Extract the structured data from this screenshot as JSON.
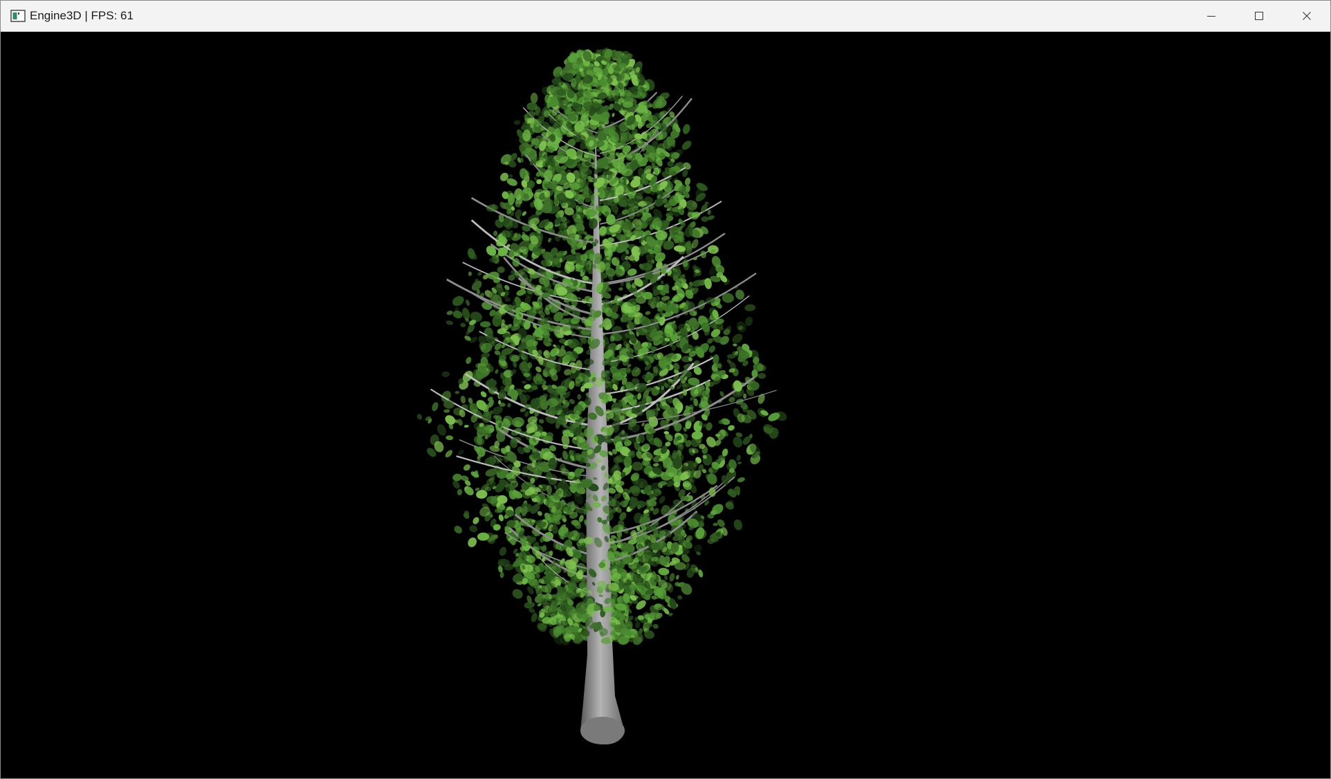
{
  "window": {
    "title": "Engine3D | FPS: 61",
    "icons": {
      "app": "app-window-icon",
      "minimize": "minimize-icon",
      "maximize": "maximize-icon",
      "close": "close-icon"
    }
  },
  "scene": {
    "background_color": "#000000",
    "foliage_color": "#4f9a33",
    "foliage_highlight": "#79c24a",
    "bark_color": "#9a9a9a",
    "object": "tree"
  }
}
